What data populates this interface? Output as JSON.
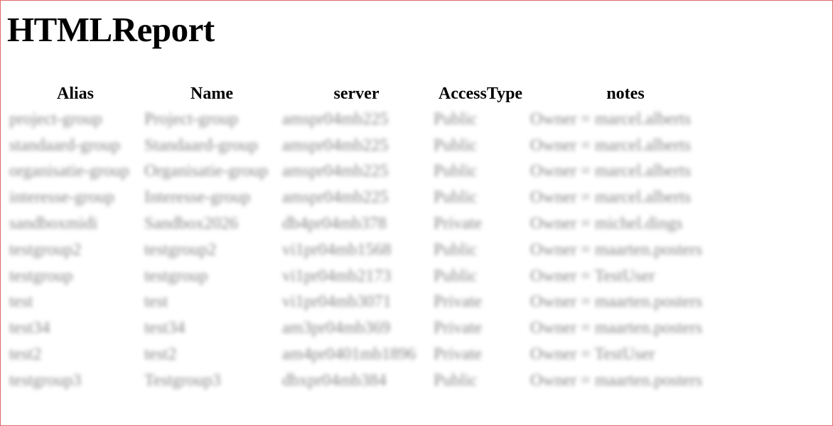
{
  "report": {
    "title": "HTMLReport"
  },
  "table": {
    "columns": [
      "Alias",
      "Name",
      "server",
      "AccessType",
      "notes"
    ],
    "rows": [
      [
        "project-group",
        "Project-group",
        "amspr04mb225",
        "Public",
        "Owner = marcel.alberts"
      ],
      [
        "standaard-group",
        "Standaard-group",
        "amspr04mb225",
        "Public",
        "Owner = marcel.alberts"
      ],
      [
        "organisatie-group",
        "Organisatie-group",
        "amspr04mb225",
        "Public",
        "Owner = marcel.alberts"
      ],
      [
        "interesse-group",
        "Interesse-group",
        "amspr04mb225",
        "Public",
        "Owner = marcel.alberts"
      ],
      [
        "sandboxmidi",
        "Sandbox2026",
        "db4pr04mb378",
        "Private",
        "Owner = michel.dings"
      ],
      [
        "testgroup2",
        "testgroup2",
        "vi1pr04mb1568",
        "Public",
        "Owner = maarten.posters"
      ],
      [
        "testgroup",
        "testgroup",
        "vi1pr04mb2173",
        "Public",
        "Owner = TestUser"
      ],
      [
        "test",
        "test",
        "vi1pr04mb3071",
        "Private",
        "Owner = maarten.posters"
      ],
      [
        "test34",
        "test34",
        "am3pr04mb369",
        "Private",
        "Owner = maarten.posters"
      ],
      [
        "test2",
        "test2",
        "am4pr0401mb1896",
        "Private",
        "Owner = TestUser"
      ],
      [
        "testgroup3",
        "Testgroup3",
        "dbxpr04mb384",
        "Public",
        "Owner = maarten.posters"
      ]
    ]
  }
}
